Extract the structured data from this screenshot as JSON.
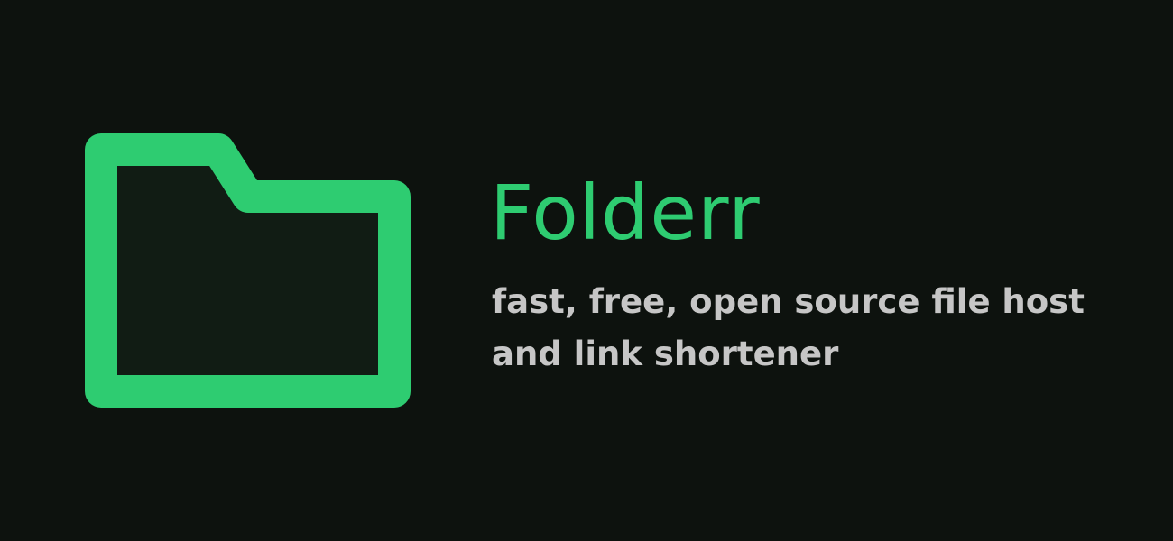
{
  "brand": {
    "name": "Folderr",
    "tagline_line1": "fast, free, open source file host",
    "tagline_line2": "and link shortener",
    "logo_icon": "folder-icon"
  },
  "colors": {
    "background": "#0d120e",
    "accent": "#2ecc71",
    "folder_fill": "#111c14",
    "tagline": "#c6c6c6"
  }
}
